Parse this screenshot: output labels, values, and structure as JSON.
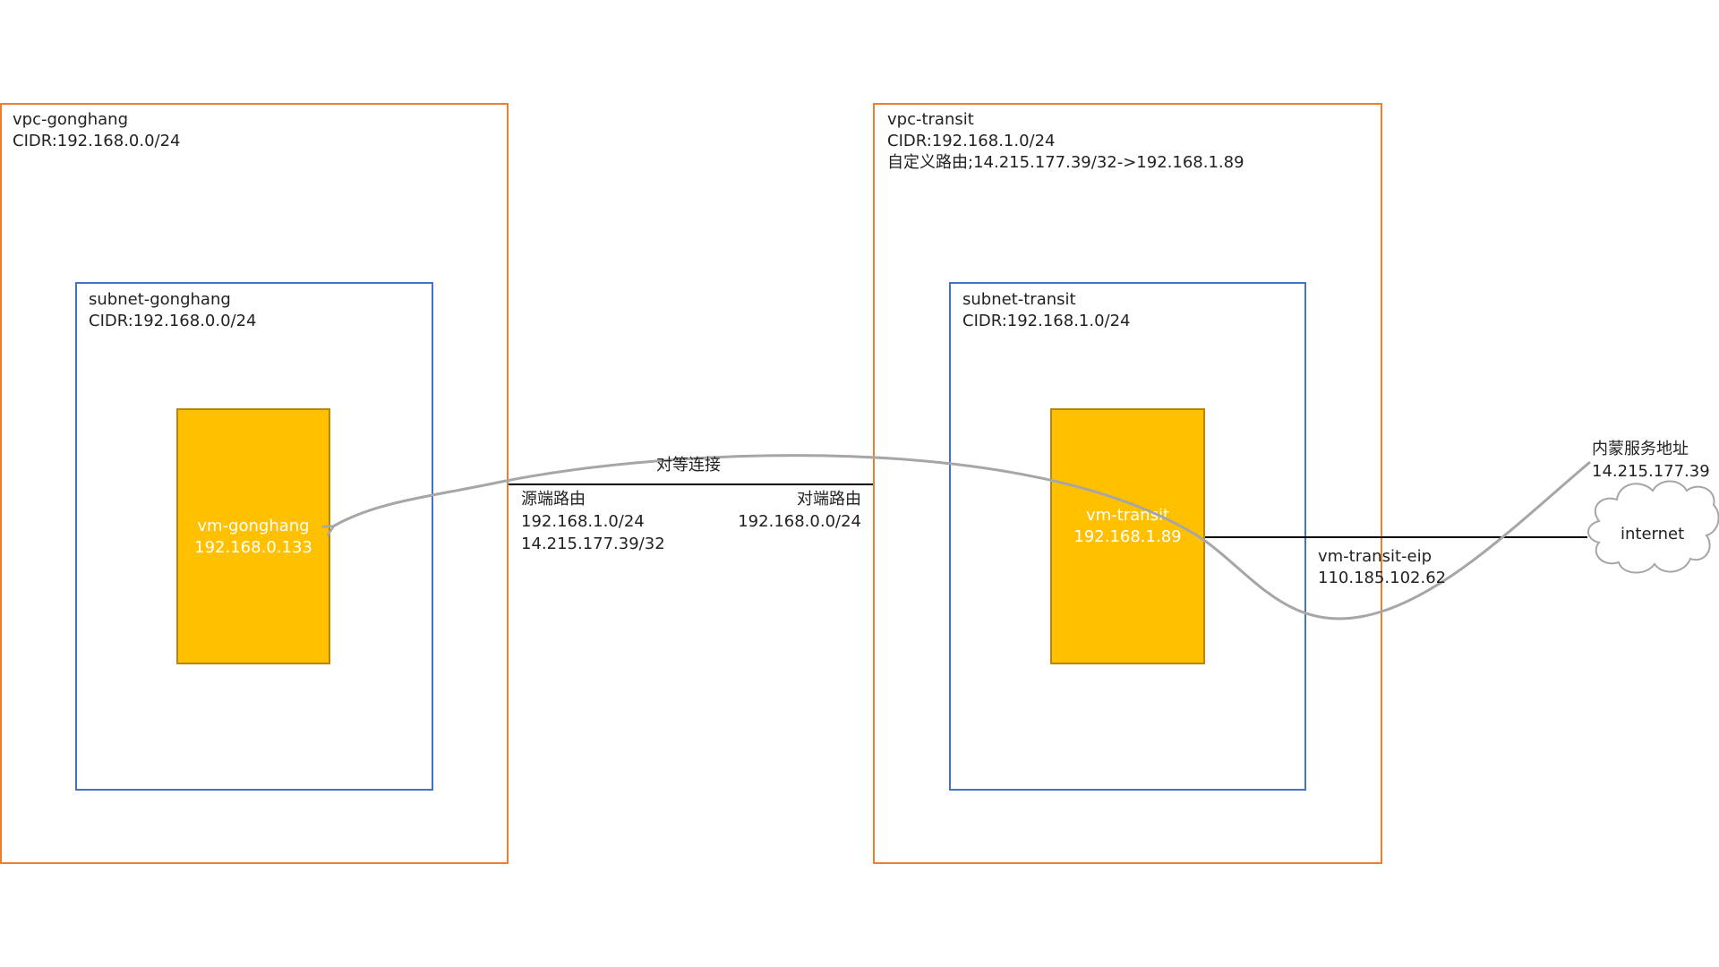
{
  "vpcs": [
    {
      "name": "vpc-gonghang",
      "cidr": "CIDR:192.168.0.0/24",
      "subnet": {
        "name": "subnet-gonghang",
        "cidr": "CIDR:192.168.0.0/24"
      },
      "vm": {
        "name": "vm-gonghang",
        "ip": "192.168.0.133"
      }
    },
    {
      "name": "vpc-transit",
      "cidr": "CIDR:192.168.1.0/24",
      "custom_route": "自定义路由;14.215.177.39/32->192.168.1.89",
      "subnet": {
        "name": "subnet-transit",
        "cidr": "CIDR:192.168.1.0/24"
      },
      "vm": {
        "name": "vm-transit",
        "ip": "192.168.1.89"
      }
    }
  ],
  "peering": {
    "label": "对等连接",
    "source_route": {
      "title": "源端路由",
      "routes": [
        "192.168.1.0/24",
        "14.215.177.39/32"
      ]
    },
    "peer_route": {
      "title": "对端路由",
      "routes": [
        "192.168.0.0/24"
      ]
    }
  },
  "eip": {
    "name": "vm-transit-eip",
    "ip": "110.185.102.62"
  },
  "internet": {
    "label": "internet"
  },
  "service": {
    "title": "内蒙服务地址",
    "ip": "14.215.177.39"
  },
  "colors": {
    "vpc_border": "#ED7D31",
    "subnet_border": "#4472C4",
    "vm_fill": "#FFC000",
    "traffic_path": "#A6A6A6"
  }
}
